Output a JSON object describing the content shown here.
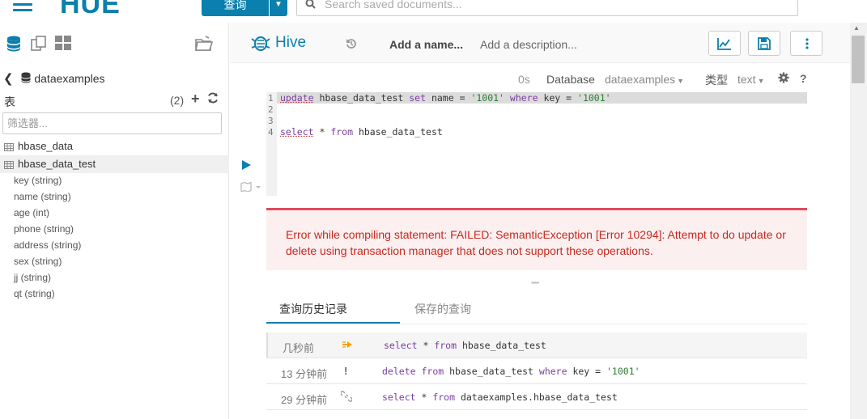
{
  "topbar": {
    "logo": "HUE",
    "query_button": "查询",
    "search_placeholder": "Search saved documents..."
  },
  "left_panel": {
    "database": "dataexamples",
    "tables_label": "表",
    "tables_count": "(2)",
    "filter_placeholder": "筛选器...",
    "tables": [
      {
        "name": "hbase_data"
      },
      {
        "name": "hbase_data_test"
      }
    ],
    "columns": [
      "key (string)",
      "name (string)",
      "age (int)",
      "phone (string)",
      "address (string)",
      "sex (string)",
      "jj (string)",
      "qt (string)"
    ]
  },
  "editor_header": {
    "engine": "Hive",
    "name_placeholder": "Add a name...",
    "description_placeholder": "Add a description..."
  },
  "snippet": {
    "elapsed": "0s",
    "database_label": "Database",
    "database_value": "dataexamples",
    "type_label": "类型",
    "type_value": "text"
  },
  "code": {
    "line_numbers": [
      "1",
      "2",
      "3",
      "4"
    ],
    "line1": {
      "kw1": "update",
      "id1": " hbase_data_test ",
      "kw2": "set",
      "id2": " name ",
      "op1": "=",
      "s1": " '1001' ",
      "kw3": "where",
      "id3": " key ",
      "op2": "=",
      "s2": " '1001'"
    },
    "line4": {
      "kw1": "select",
      "id1": " * ",
      "kw2": "from",
      "id2": " hbase_data_test"
    }
  },
  "error": {
    "message": "Error while compiling statement: FAILED: SemanticException [Error 10294]: Attempt to do update or delete using transaction manager that does not support these operations."
  },
  "tabs": [
    {
      "label": "查询历史记录"
    },
    {
      "label": "保存的查询"
    }
  ],
  "history": [
    {
      "time": "几秒前",
      "status": "running",
      "sql": {
        "kw1": "select",
        "mid": " * ",
        "kw2": "from",
        "tail": " hbase_data_test"
      }
    },
    {
      "time": "13 分钟前",
      "status": "failed",
      "sql": {
        "kw1": "delete",
        "mid": " ",
        "kw2": "from",
        "tail": " hbase_data_test ",
        "kw3": "where",
        "tail2": " key ",
        "op": "=",
        "str": " '1001'"
      }
    },
    {
      "time": "29 分钟前",
      "status": "expired",
      "sql": {
        "kw1": "select",
        "mid": " * ",
        "kw2": "from",
        "tail": " dataexamples.hbase_data_test"
      }
    }
  ],
  "colors": {
    "brand": "#0B7FAD",
    "error_text": "#c7291d",
    "error_border": "#e2495a",
    "keyword": "#7a3e9d",
    "string": "#2e7d32"
  }
}
